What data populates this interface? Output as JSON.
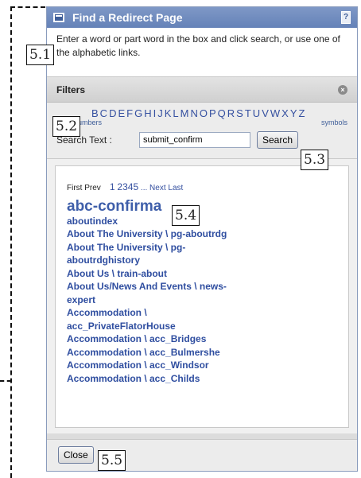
{
  "dialog": {
    "title": "Find a Redirect Page",
    "help_icon": "help-icon",
    "intro": "Enter a word or part word in the box and click search, or use one of the alphabetic links."
  },
  "filters": {
    "title": "Filters",
    "close_icon": "close-circle-icon",
    "alphabet_visible": [
      "B",
      "C",
      "D",
      "E",
      "F",
      "G",
      "H",
      "I",
      "J",
      "K",
      "L",
      "M",
      "N",
      "O",
      "P",
      "Q",
      "R",
      "S",
      "T",
      "U",
      "V",
      "W",
      "X",
      "Y",
      "Z"
    ],
    "numbers_label": "numbers",
    "symbols_label": "symbols",
    "search_label": "Search Text :",
    "search_value": "submit_confirm",
    "search_button": "Search"
  },
  "results": {
    "pager": {
      "first": "First",
      "prev": "Prev",
      "pages": [
        "1",
        "2",
        "3",
        "4",
        "5"
      ],
      "ellipsis": "...",
      "next": "Next",
      "last": "Last"
    },
    "hero": "abc-confirma",
    "items": [
      "aboutindex",
      "About The University \\ pg-aboutrdg",
      "About The University \\ pg-",
      "aboutrdghistory",
      "About Us \\ train-about",
      "About Us/News And Events \\ news-",
      "expert",
      "Accommodation \\",
      "acc_PrivateFlatorHouse",
      "Accommodation \\ acc_Bridges",
      "Accommodation \\ acc_Bulmershe",
      "Accommodation \\ acc_Windsor",
      "Accommodation \\ acc_Childs"
    ]
  },
  "footer": {
    "close_button": "Close"
  },
  "callouts": {
    "c1": "5.1",
    "c2": "5.2",
    "c3": "5.3",
    "c4": "5.4",
    "c5": "5.5"
  },
  "colors": {
    "title_bar": "#6f8bbf",
    "link": "#2f4ea0"
  }
}
